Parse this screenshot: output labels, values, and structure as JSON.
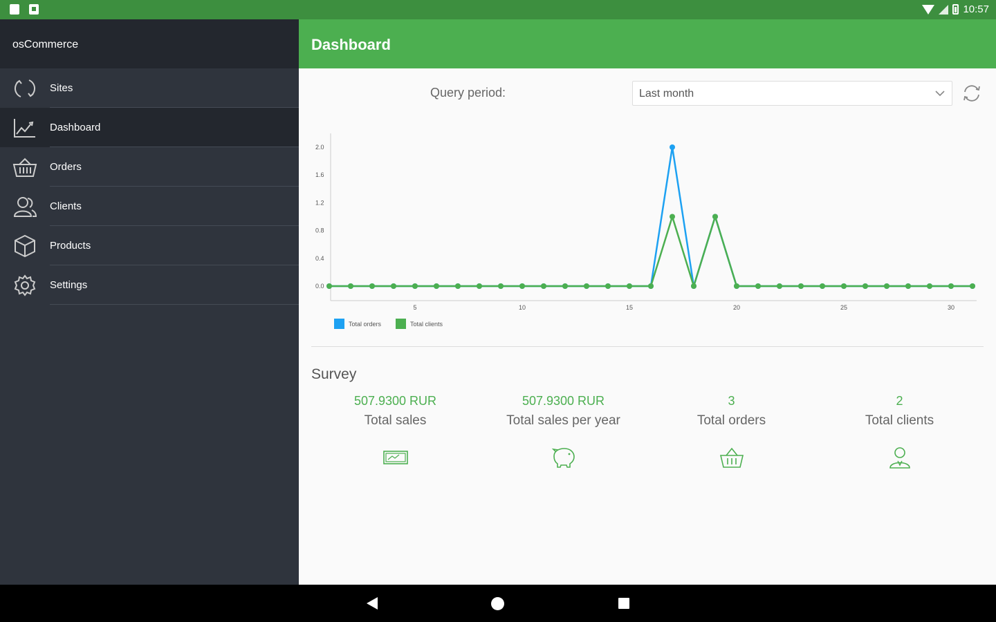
{
  "status_bar": {
    "time": "10:57"
  },
  "sidebar": {
    "app_name": "osCommerce",
    "items": [
      {
        "label": "Sites",
        "icon": "refresh-circle-icon",
        "active": false
      },
      {
        "label": "Dashboard",
        "icon": "line-chart-icon",
        "active": true
      },
      {
        "label": "Orders",
        "icon": "basket-icon",
        "active": false
      },
      {
        "label": "Clients",
        "icon": "users-icon",
        "active": false
      },
      {
        "label": "Products",
        "icon": "cube-icon",
        "active": false
      },
      {
        "label": "Settings",
        "icon": "gear-icon",
        "active": false
      }
    ]
  },
  "header": {
    "title": "Dashboard"
  },
  "query": {
    "label": "Query period:",
    "selected": "Last month"
  },
  "colors": {
    "accent": "#4caf50",
    "orders_series": "#1da1f2",
    "clients_series": "#4caf50"
  },
  "chart_data": {
    "type": "line",
    "x": [
      1,
      2,
      3,
      4,
      5,
      6,
      7,
      8,
      9,
      10,
      11,
      12,
      13,
      14,
      15,
      16,
      17,
      18,
      19,
      20,
      21,
      22,
      23,
      24,
      25,
      26,
      27,
      28,
      29,
      30,
      31
    ],
    "x_ticks": [
      5,
      10,
      15,
      20,
      25,
      30
    ],
    "y_ticks": [
      "0.0",
      "0.4",
      "0.8",
      "1.2",
      "1.6",
      "2.0"
    ],
    "ylim": [
      0,
      2
    ],
    "series": [
      {
        "name": "Total orders",
        "values": [
          0,
          0,
          0,
          0,
          0,
          0,
          0,
          0,
          0,
          0,
          0,
          0,
          0,
          0,
          0,
          0,
          2,
          0,
          1,
          0,
          0,
          0,
          0,
          0,
          0,
          0,
          0,
          0,
          0,
          0,
          0
        ]
      },
      {
        "name": "Total clients",
        "values": [
          0,
          0,
          0,
          0,
          0,
          0,
          0,
          0,
          0,
          0,
          0,
          0,
          0,
          0,
          0,
          0,
          1,
          0,
          1,
          0,
          0,
          0,
          0,
          0,
          0,
          0,
          0,
          0,
          0,
          0,
          0
        ]
      }
    ],
    "legend": "bottom-left",
    "grid": false
  },
  "survey": {
    "title": "Survey",
    "stats": [
      {
        "value": "507.9300 RUR",
        "label": "Total sales",
        "icon": "money-card-icon"
      },
      {
        "value": "507.9300 RUR",
        "label": "Total sales per year",
        "icon": "piggy-bank-icon"
      },
      {
        "value": "3",
        "label": "Total orders",
        "icon": "basket-icon"
      },
      {
        "value": "2",
        "label": "Total clients",
        "icon": "user-icon"
      }
    ]
  }
}
